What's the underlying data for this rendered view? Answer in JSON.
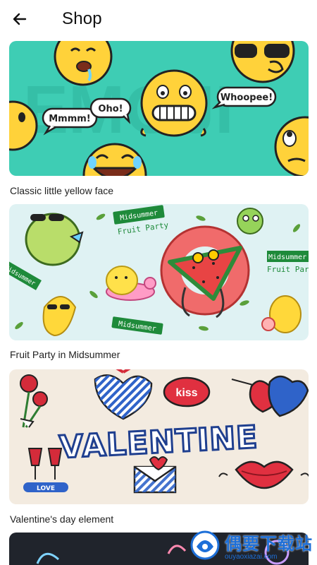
{
  "header": {
    "title": "Shop",
    "back_icon": "arrow-left-icon"
  },
  "items": [
    {
      "label": "Classic little yellow face",
      "bubbles": [
        "Mmmm!",
        "Oho!",
        "Whoopee!"
      ],
      "bg_text": "EMOJI",
      "accent": "#3ecdb4"
    },
    {
      "label": "Fruit Party in Midsummer",
      "sign_line1": "Midsummer",
      "sign_line2": "Fruit Party",
      "accent": "#dff2f3"
    },
    {
      "label": "Valentine's day element",
      "headline": "VALENTINE",
      "kiss": "kiss",
      "love": "LOVE",
      "accent": "#f3ebe0"
    },
    {
      "accent": "#20242c"
    }
  ],
  "watermark": {
    "text": "偶要下载站",
    "url": "ouyaoxiazai.com"
  }
}
